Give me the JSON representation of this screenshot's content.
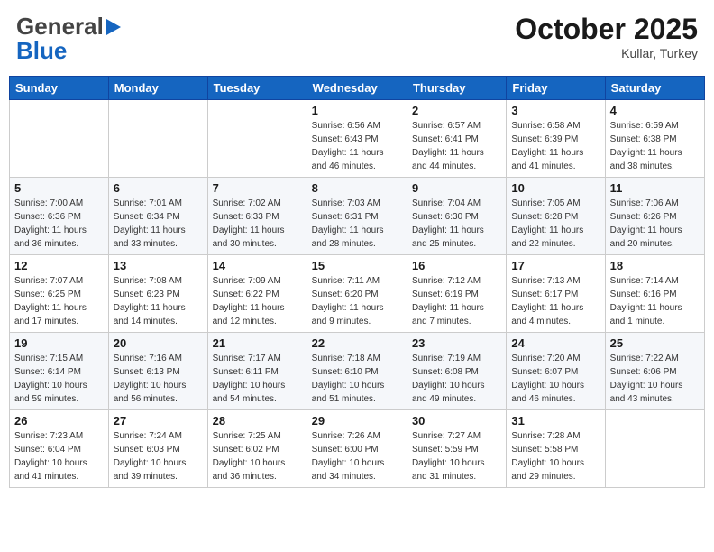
{
  "header": {
    "logo_general": "General",
    "logo_blue": "Blue",
    "month": "October 2025",
    "location": "Kullar, Turkey"
  },
  "weekdays": [
    "Sunday",
    "Monday",
    "Tuesday",
    "Wednesday",
    "Thursday",
    "Friday",
    "Saturday"
  ],
  "weeks": [
    [
      {
        "day": "",
        "info": ""
      },
      {
        "day": "",
        "info": ""
      },
      {
        "day": "",
        "info": ""
      },
      {
        "day": "1",
        "info": "Sunrise: 6:56 AM\nSunset: 6:43 PM\nDaylight: 11 hours\nand 46 minutes."
      },
      {
        "day": "2",
        "info": "Sunrise: 6:57 AM\nSunset: 6:41 PM\nDaylight: 11 hours\nand 44 minutes."
      },
      {
        "day": "3",
        "info": "Sunrise: 6:58 AM\nSunset: 6:39 PM\nDaylight: 11 hours\nand 41 minutes."
      },
      {
        "day": "4",
        "info": "Sunrise: 6:59 AM\nSunset: 6:38 PM\nDaylight: 11 hours\nand 38 minutes."
      }
    ],
    [
      {
        "day": "5",
        "info": "Sunrise: 7:00 AM\nSunset: 6:36 PM\nDaylight: 11 hours\nand 36 minutes."
      },
      {
        "day": "6",
        "info": "Sunrise: 7:01 AM\nSunset: 6:34 PM\nDaylight: 11 hours\nand 33 minutes."
      },
      {
        "day": "7",
        "info": "Sunrise: 7:02 AM\nSunset: 6:33 PM\nDaylight: 11 hours\nand 30 minutes."
      },
      {
        "day": "8",
        "info": "Sunrise: 7:03 AM\nSunset: 6:31 PM\nDaylight: 11 hours\nand 28 minutes."
      },
      {
        "day": "9",
        "info": "Sunrise: 7:04 AM\nSunset: 6:30 PM\nDaylight: 11 hours\nand 25 minutes."
      },
      {
        "day": "10",
        "info": "Sunrise: 7:05 AM\nSunset: 6:28 PM\nDaylight: 11 hours\nand 22 minutes."
      },
      {
        "day": "11",
        "info": "Sunrise: 7:06 AM\nSunset: 6:26 PM\nDaylight: 11 hours\nand 20 minutes."
      }
    ],
    [
      {
        "day": "12",
        "info": "Sunrise: 7:07 AM\nSunset: 6:25 PM\nDaylight: 11 hours\nand 17 minutes."
      },
      {
        "day": "13",
        "info": "Sunrise: 7:08 AM\nSunset: 6:23 PM\nDaylight: 11 hours\nand 14 minutes."
      },
      {
        "day": "14",
        "info": "Sunrise: 7:09 AM\nSunset: 6:22 PM\nDaylight: 11 hours\nand 12 minutes."
      },
      {
        "day": "15",
        "info": "Sunrise: 7:11 AM\nSunset: 6:20 PM\nDaylight: 11 hours\nand 9 minutes."
      },
      {
        "day": "16",
        "info": "Sunrise: 7:12 AM\nSunset: 6:19 PM\nDaylight: 11 hours\nand 7 minutes."
      },
      {
        "day": "17",
        "info": "Sunrise: 7:13 AM\nSunset: 6:17 PM\nDaylight: 11 hours\nand 4 minutes."
      },
      {
        "day": "18",
        "info": "Sunrise: 7:14 AM\nSunset: 6:16 PM\nDaylight: 11 hours\nand 1 minute."
      }
    ],
    [
      {
        "day": "19",
        "info": "Sunrise: 7:15 AM\nSunset: 6:14 PM\nDaylight: 10 hours\nand 59 minutes."
      },
      {
        "day": "20",
        "info": "Sunrise: 7:16 AM\nSunset: 6:13 PM\nDaylight: 10 hours\nand 56 minutes."
      },
      {
        "day": "21",
        "info": "Sunrise: 7:17 AM\nSunset: 6:11 PM\nDaylight: 10 hours\nand 54 minutes."
      },
      {
        "day": "22",
        "info": "Sunrise: 7:18 AM\nSunset: 6:10 PM\nDaylight: 10 hours\nand 51 minutes."
      },
      {
        "day": "23",
        "info": "Sunrise: 7:19 AM\nSunset: 6:08 PM\nDaylight: 10 hours\nand 49 minutes."
      },
      {
        "day": "24",
        "info": "Sunrise: 7:20 AM\nSunset: 6:07 PM\nDaylight: 10 hours\nand 46 minutes."
      },
      {
        "day": "25",
        "info": "Sunrise: 7:22 AM\nSunset: 6:06 PM\nDaylight: 10 hours\nand 43 minutes."
      }
    ],
    [
      {
        "day": "26",
        "info": "Sunrise: 7:23 AM\nSunset: 6:04 PM\nDaylight: 10 hours\nand 41 minutes."
      },
      {
        "day": "27",
        "info": "Sunrise: 7:24 AM\nSunset: 6:03 PM\nDaylight: 10 hours\nand 39 minutes."
      },
      {
        "day": "28",
        "info": "Sunrise: 7:25 AM\nSunset: 6:02 PM\nDaylight: 10 hours\nand 36 minutes."
      },
      {
        "day": "29",
        "info": "Sunrise: 7:26 AM\nSunset: 6:00 PM\nDaylight: 10 hours\nand 34 minutes."
      },
      {
        "day": "30",
        "info": "Sunrise: 7:27 AM\nSunset: 5:59 PM\nDaylight: 10 hours\nand 31 minutes."
      },
      {
        "day": "31",
        "info": "Sunrise: 7:28 AM\nSunset: 5:58 PM\nDaylight: 10 hours\nand 29 minutes."
      },
      {
        "day": "",
        "info": ""
      }
    ]
  ]
}
